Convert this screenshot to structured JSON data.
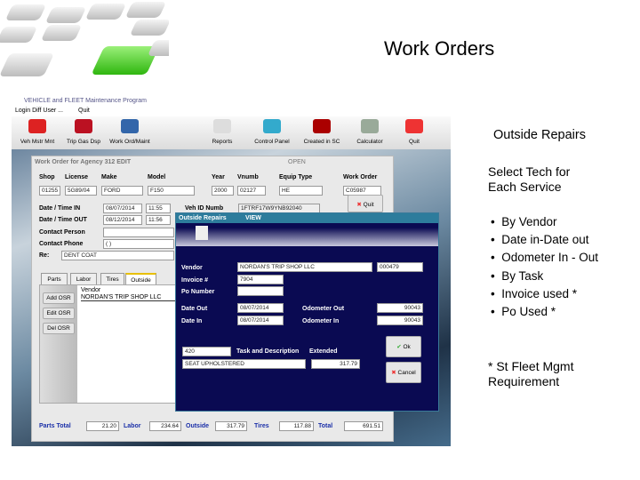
{
  "slide": {
    "title": "Work Orders",
    "subtitle": "Outside Repairs",
    "intro": "Select Tech for Each Service",
    "bullets": [
      "By Vendor",
      "Date in-Date out",
      "Odometer In - Out",
      "By Task",
      "Invoice used *",
      "Po Used *"
    ],
    "footnote": "* St Fleet Mgmt Requirement"
  },
  "app": {
    "title": "VEHICLE and FLEET Maintenance Program",
    "menu": [
      "Login Diff User ...",
      "Quit"
    ],
    "toolbar": [
      {
        "label": "Veh Mstr Mnt",
        "icon": "car-icon",
        "color": "#d22"
      },
      {
        "label": "Trip Gas Dsp",
        "icon": "gas-pump-icon",
        "color": "#b12"
      },
      {
        "label": "Work Ord/Maint",
        "icon": "tools-icon",
        "color": "#36a"
      },
      {
        "label": "Reports",
        "icon": "report-icon",
        "color": "#ddd"
      },
      {
        "label": "Control Panel",
        "icon": "control-panel-icon",
        "color": "#3ac"
      },
      {
        "label": "Created in SC",
        "icon": "sc-state-icon",
        "color": "#a00"
      },
      {
        "label": "Calculator",
        "icon": "calculator-icon",
        "color": "#9a9"
      },
      {
        "label": "Quit",
        "icon": "close-icon",
        "color": "#e33"
      }
    ],
    "work_order": {
      "header": "Work Order for Agency 312  EDIT",
      "status": "OPEN",
      "columns": [
        "Shop",
        "License",
        "Make",
        "Model",
        "Year",
        "Vnumb",
        "Equip Type",
        "Work Order"
      ],
      "values": [
        "01255",
        "5G89/04",
        "FORD",
        "F150",
        "2000",
        "02127",
        "HE",
        "C05987"
      ],
      "quit": "Quit",
      "date_in_label": "Date / Time IN",
      "date_in": "08/07/2014",
      "time_in": "11:55",
      "date_out_label": "Date / Time OUT",
      "date_out": "08/12/2014",
      "time_out": "11:56",
      "vehid_label": "Veh ID Numb",
      "vehid": "1FTRF17W9YNB92040",
      "contact_person_label": "Contact Person",
      "contact_person": "",
      "contact_phone_label": "Contact Phone",
      "contact_phone": "( )",
      "re_label": "Re:",
      "re": "DENT COAT",
      "tabs": [
        "Parts",
        "Labor",
        "Tires",
        "Outside"
      ],
      "active_tab": "Outside",
      "buttons": [
        "Add OSR",
        "Edit OSR",
        "Del OSR"
      ],
      "list_header": "Vendor",
      "list_rows": [
        "NORDAN'S TRIP SHOP LLC"
      ],
      "totals": [
        {
          "label": "Parts Total",
          "value": "21.20"
        },
        {
          "label": "Labor",
          "value": "234.64"
        },
        {
          "label": "Outside",
          "value": "317.79"
        },
        {
          "label": "Tires",
          "value": "117.88"
        },
        {
          "label": "Total",
          "value": "691.51"
        }
      ]
    },
    "dialog": {
      "title": "Outside Repairs",
      "mode": "VIEW",
      "vendor_label": "Vendor",
      "vendor": "NORDAN'S TRIP SHOP LLC",
      "vendor_code": "000479",
      "invoice_label": "Invoice #",
      "invoice": "7904",
      "po_label": "Po Number",
      "po": "",
      "date_out_label": "Date Out",
      "date_out": "08/07/2014",
      "odo_out_label": "Odometer Out",
      "odo_out": "90043",
      "date_in_label": "Date In",
      "date_in": "08/07/2014",
      "odo_in_label": "Odometer In",
      "odo_in": "90043",
      "task_code": "420",
      "task_label": "Task and Description",
      "extended_label": "Extended",
      "task_desc": "SEAT UPHOLSTERED",
      "extended": "317.79",
      "ok": "Ok",
      "cancel": "Cancel"
    }
  }
}
